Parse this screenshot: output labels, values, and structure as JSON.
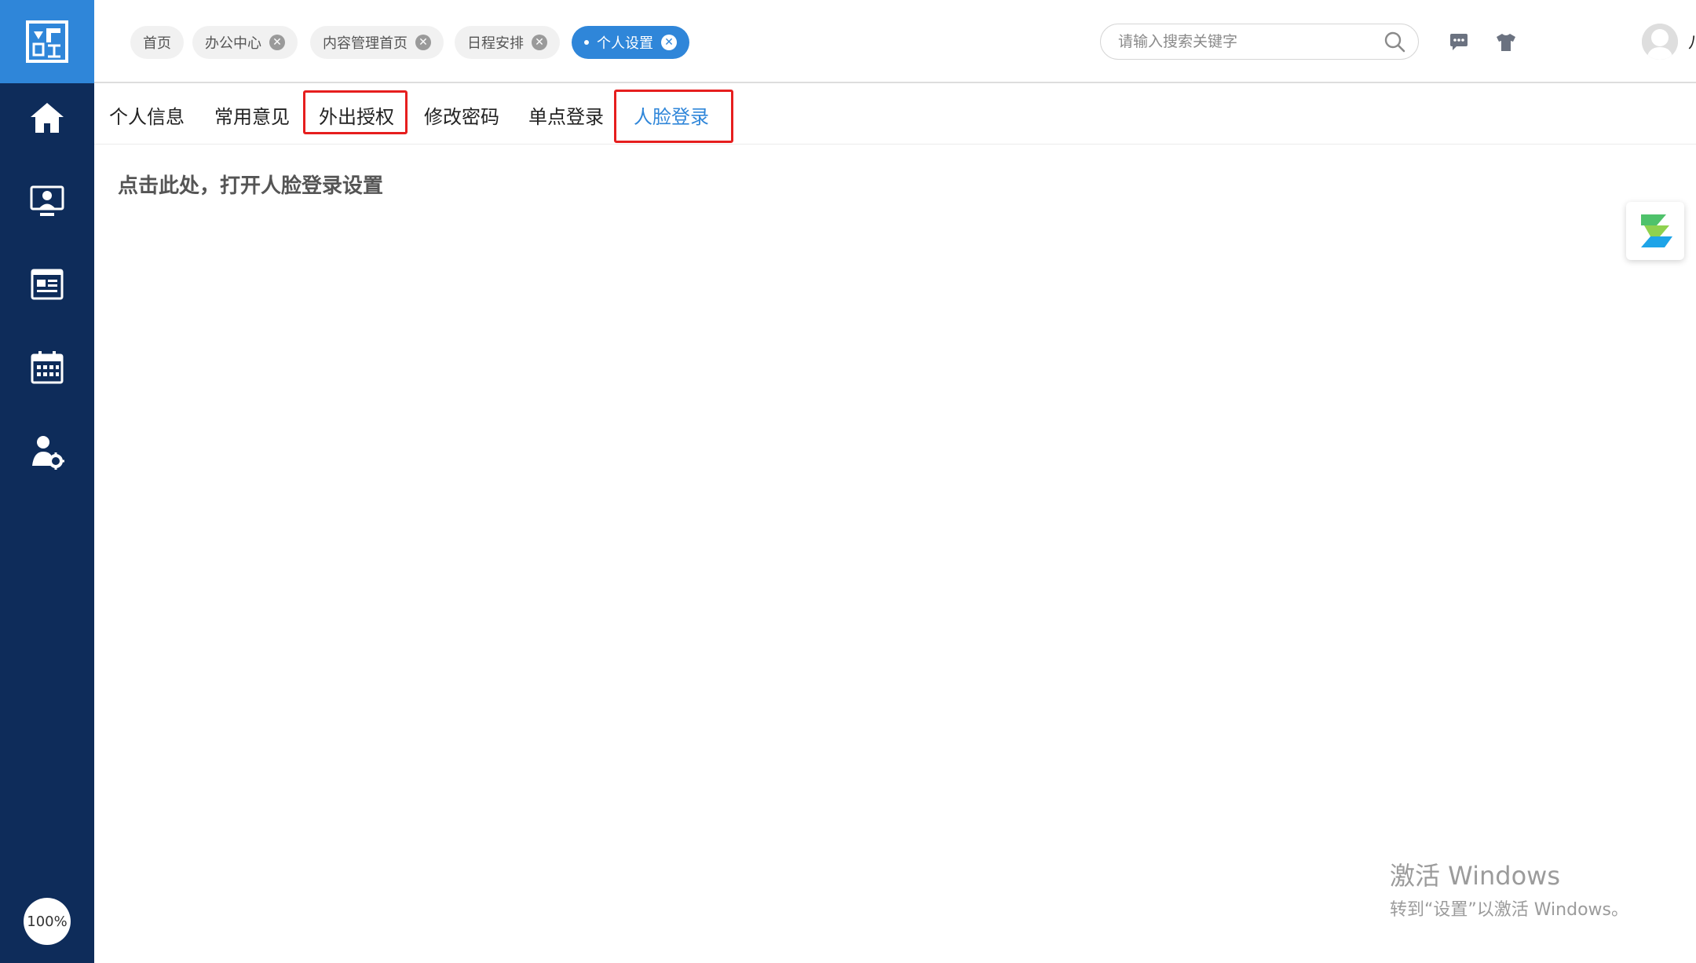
{
  "colors": {
    "sidebar_bg": "#0e2c5a",
    "logo_bg": "#2f86d9",
    "accent": "#2f86d9",
    "highlight_frame": "#e61e1e"
  },
  "sidebar": {
    "logo_icon": "logo-icon",
    "items": [
      {
        "icon": "home-icon"
      },
      {
        "icon": "monitor-user-icon"
      },
      {
        "icon": "news-icon"
      },
      {
        "icon": "calendar-icon"
      },
      {
        "icon": "user-settings-icon"
      }
    ],
    "zoom_label": "100%"
  },
  "header": {
    "tabs": [
      {
        "label": "首页",
        "closable": false,
        "active": false
      },
      {
        "label": "办公中心",
        "closable": true,
        "active": false
      },
      {
        "label": "内容管理首页",
        "closable": true,
        "active": false
      },
      {
        "label": "日程安排",
        "closable": true,
        "active": false
      },
      {
        "label": "个人设置",
        "closable": true,
        "active": true
      }
    ],
    "search": {
      "placeholder": "请输入搜索关键字",
      "value": ""
    },
    "user_name": "八一街道A"
  },
  "subtabs": {
    "items": [
      {
        "label": "个人信息"
      },
      {
        "label": "常用意见"
      },
      {
        "label": "外出授权"
      },
      {
        "label": "修改密码"
      },
      {
        "label": "单点登录"
      },
      {
        "label": "人脸登录"
      }
    ],
    "active_label": "人脸登录"
  },
  "content": {
    "open_settings_link": "点击此处，打开人脸登录设置"
  },
  "watermark": {
    "line1": "激活 Windows",
    "line2": "转到“设置”以激活 Windows。"
  }
}
